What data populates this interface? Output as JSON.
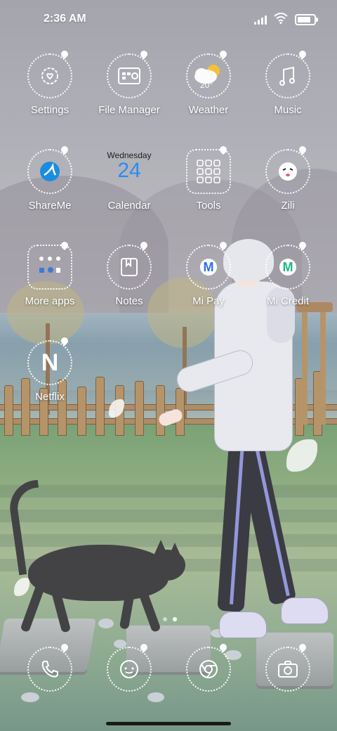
{
  "status": {
    "time": "2:36 AM",
    "icons": [
      "signal-icon",
      "wifi-icon",
      "battery-icon"
    ],
    "battery_level": 1.0
  },
  "apps": [
    {
      "label": "Settings",
      "icon": "gear-icon"
    },
    {
      "label": "File Manager",
      "icon": "folder-icon"
    },
    {
      "label": "Weather",
      "icon": "sun-cloud-icon",
      "temp": "20°"
    },
    {
      "label": "Music",
      "icon": "music-note-icon"
    },
    {
      "label": "ShareMe",
      "icon": "shareme-icon"
    },
    {
      "label": "Calendar",
      "icon": "calendar-icon",
      "weekday": "Wednesday",
      "weekday_short": "Wed",
      "day": "24"
    },
    {
      "label": "Tools",
      "icon": "tools-folder-icon"
    },
    {
      "label": "Zili",
      "icon": "zili-icon"
    },
    {
      "label": "More apps",
      "icon": "apps-folder-icon"
    },
    {
      "label": "Notes",
      "icon": "notes-icon"
    },
    {
      "label": "Mi Pay",
      "icon": "mi-pay-icon",
      "letter": "M"
    },
    {
      "label": "Mi Credit",
      "icon": "mi-credit-icon",
      "letter": "M"
    },
    {
      "label": "Netflix",
      "icon": "netflix-icon",
      "letter": "N"
    }
  ],
  "page_indicator": {
    "pages": 2,
    "current": 2
  },
  "dock": [
    {
      "icon": "phone-icon"
    },
    {
      "icon": "messages-icon"
    },
    {
      "icon": "browser-icon"
    },
    {
      "icon": "camera-icon"
    }
  ],
  "colors": {
    "accent": "#2d6cf0",
    "mi_credit": "#1bb88a",
    "calendar_blue": "#2a8cf0"
  }
}
